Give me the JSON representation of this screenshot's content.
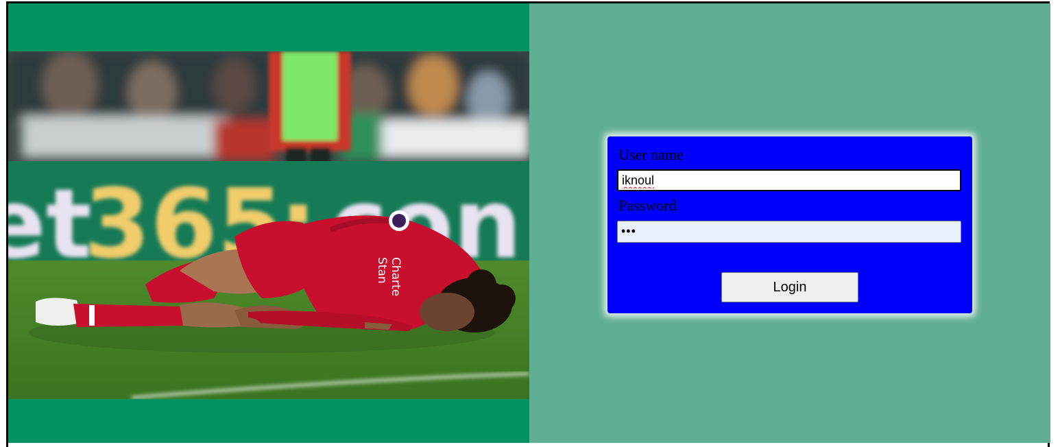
{
  "login": {
    "username_label": "User name",
    "username_value": "iknoul",
    "password_label": "Password",
    "password_mask": "•••",
    "login_button": "Login"
  },
  "colors": {
    "left_background": "#00935f",
    "right_background": "#60ae94",
    "card_background": "#0000ff",
    "password_field": "#e8f0fe"
  },
  "photo": {
    "subject": "footballer in red kit lying on grass pitch",
    "board_text": "et365.con"
  }
}
